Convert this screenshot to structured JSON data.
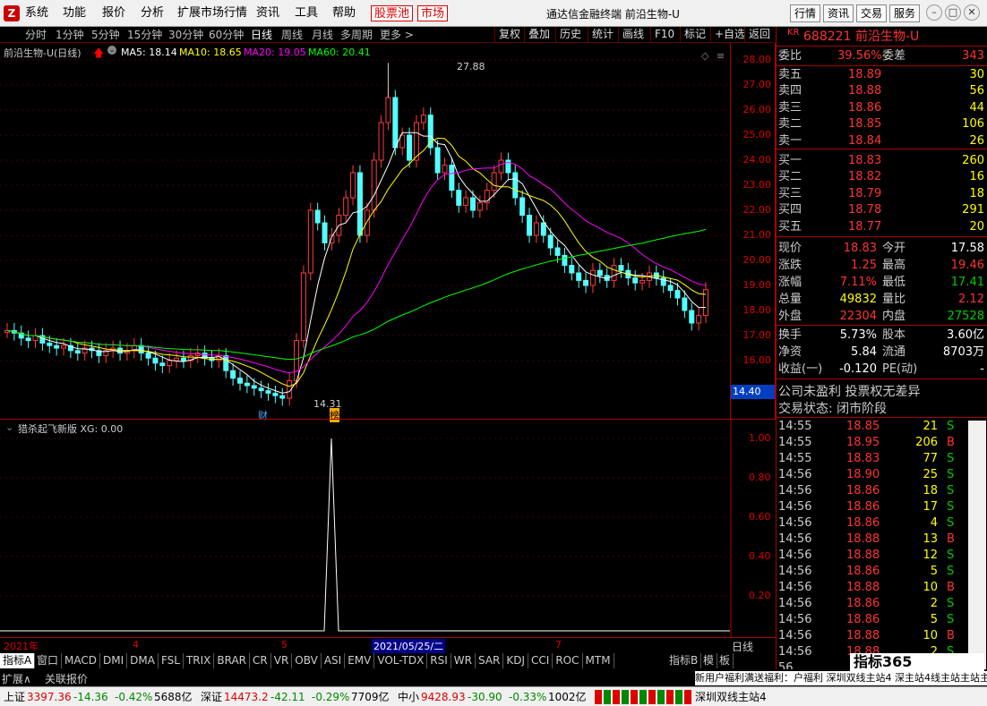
{
  "menu": {
    "items": [
      "系统",
      "功能",
      "报价",
      "分析",
      "扩展市场行情",
      "资讯",
      "工具",
      "帮助"
    ],
    "red_items": [
      "股票池",
      "市场"
    ],
    "window_title": "通达信金融终端 前沿生物-U",
    "right_buttons": [
      "行情",
      "资讯",
      "交易",
      "服务"
    ]
  },
  "toolbar": {
    "periods": [
      "分时",
      "1分钟",
      "5分钟",
      "15分钟",
      "30分钟",
      "60分钟",
      "日线",
      "周线",
      "月线",
      "多周期",
      "更多 >"
    ],
    "active_period": "日线",
    "right": [
      "复权",
      "叠加",
      "历史",
      "统计",
      "画线",
      "F10",
      "标记",
      "+自选",
      "返回"
    ]
  },
  "chart": {
    "title": "前沿生物-U(日线)",
    "ma": [
      {
        "label": "MA5: 18.14",
        "color": "#ffffff"
      },
      {
        "label": "MA10: 18.65",
        "color": "#ffff00"
      },
      {
        "label": "MA20: 19.05",
        "color": "#ff00ff"
      },
      {
        "label": "MA60: 20.41",
        "color": "#00ff00"
      }
    ],
    "high_label": "27.88",
    "low_label": "14.31",
    "cai_tag": "财",
    "bang_tag": "榜",
    "price_box": "14.40",
    "y_ticks": [
      "28.00",
      "27.00",
      "26.00",
      "25.00",
      "24.00",
      "23.00",
      "22.00",
      "21.00",
      "20.00",
      "19.00",
      "18.00",
      "17.00",
      "16.00"
    ]
  },
  "indicator": {
    "title": "猎杀起飞新版 XG: 0.00",
    "y_ticks": [
      "1.00",
      "0.80",
      "0.60",
      "0.40",
      "0.20"
    ]
  },
  "dates": {
    "labels": [
      "2021年",
      "4",
      "5",
      "2021/05/25/二",
      "7"
    ],
    "period_btn": "日线"
  },
  "tabs": {
    "first": "指标A",
    "items": [
      "窗口",
      "MACD",
      "DMI",
      "DMA",
      "FSL",
      "TRIX",
      "BRAR",
      "CR",
      "VR",
      "OBV",
      "ASI",
      "EMV",
      "VOL-TDX",
      "RSI",
      "WR",
      "SAR",
      "KDJ",
      "CCI",
      "ROC",
      "MTM"
    ],
    "right": [
      "指标B",
      "模",
      "板"
    ]
  },
  "bottom": {
    "left_tabs": [
      "扩展∧",
      "关联报价"
    ],
    "ticker": "新用户福利满送福利：户福利  深圳双线主站4  深主站4线主站主站主站主站"
  },
  "quote": {
    "kr": "KR",
    "code": "688221",
    "name": "前沿生物-U",
    "weibi_label": "委比",
    "weibi": "39.56%",
    "weicha_label": "委差",
    "weicha": "343",
    "asks": [
      {
        "label": "卖五",
        "price": "18.89",
        "vol": "30"
      },
      {
        "label": "卖四",
        "price": "18.88",
        "vol": "56"
      },
      {
        "label": "卖三",
        "price": "18.86",
        "vol": "44"
      },
      {
        "label": "卖二",
        "price": "18.85",
        "vol": "106"
      },
      {
        "label": "卖一",
        "price": "18.84",
        "vol": "26"
      }
    ],
    "bids": [
      {
        "label": "买一",
        "price": "18.83",
        "vol": "260"
      },
      {
        "label": "买二",
        "price": "18.82",
        "vol": "16"
      },
      {
        "label": "买三",
        "price": "18.79",
        "vol": "18"
      },
      {
        "label": "买四",
        "price": "18.78",
        "vol": "291"
      },
      {
        "label": "买五",
        "price": "18.77",
        "vol": "20"
      }
    ],
    "stats": [
      {
        "l1": "现价",
        "v1": "18.83",
        "c1": "vr",
        "l2": "今开",
        "v2": "17.58",
        "c2": "vw"
      },
      {
        "l1": "涨跌",
        "v1": "1.25",
        "c1": "vr",
        "l2": "最高",
        "v2": "19.46",
        "c2": "vr"
      },
      {
        "l1": "涨幅",
        "v1": "7.11%",
        "c1": "vr",
        "l2": "最低",
        "v2": "17.41",
        "c2": "vg"
      },
      {
        "l1": "总量",
        "v1": "49832",
        "c1": "vy",
        "l2": "量比",
        "v2": "2.12",
        "c2": "vr"
      },
      {
        "l1": "外盘",
        "v1": "22304",
        "c1": "vr",
        "l2": "内盘",
        "v2": "27528",
        "c2": "vg"
      }
    ],
    "stats2": [
      {
        "l1": "换手",
        "v1": "5.73%",
        "l2": "股本",
        "v2": "3.60亿"
      },
      {
        "l1": "净资",
        "v1": "5.84",
        "l2": "流通",
        "v2": "8703万"
      },
      {
        "l1": "收益(一)",
        "v1": "-0.120",
        "l2": "PE(动)",
        "v2": "-"
      }
    ],
    "note1": "公司未盈利 投票权无差异",
    "note2": "交易状态: 闭市阶段",
    "ticks": [
      {
        "t": "14:55",
        "p": "18.85",
        "v": "21",
        "s": "S"
      },
      {
        "t": "14:55",
        "p": "18.95",
        "v": "206",
        "s": "B"
      },
      {
        "t": "14:55",
        "p": "18.83",
        "v": "77",
        "s": "S"
      },
      {
        "t": "14:56",
        "p": "18.90",
        "v": "25",
        "s": "S"
      },
      {
        "t": "14:56",
        "p": "18.86",
        "v": "18",
        "s": "S"
      },
      {
        "t": "14:56",
        "p": "18.86",
        "v": "17",
        "s": "S"
      },
      {
        "t": "14:56",
        "p": "18.86",
        "v": "4",
        "s": "S"
      },
      {
        "t": "14:56",
        "p": "18.88",
        "v": "13",
        "s": "B"
      },
      {
        "t": "14:56",
        "p": "18.88",
        "v": "12",
        "s": "S"
      },
      {
        "t": "14:56",
        "p": "18.86",
        "v": "5",
        "s": "S"
      },
      {
        "t": "14:56",
        "p": "18.88",
        "v": "10",
        "s": "B"
      },
      {
        "t": "14:56",
        "p": "18.86",
        "v": "2",
        "s": "S"
      },
      {
        "t": "14:56",
        "p": "18.86",
        "v": "5",
        "s": "S"
      },
      {
        "t": "14:56",
        "p": "18.88",
        "v": "10",
        "s": "B"
      },
      {
        "t": "14:56",
        "p": "18.88",
        "v": "2",
        "s": "S"
      },
      {
        "t": "56",
        "p": "",
        "v": "",
        "s": ""
      }
    ]
  },
  "status": {
    "items": [
      {
        "name": "上证",
        "val": "3397.36",
        "chg": "-14.36",
        "pct": "-0.42%",
        "amt": "5688亿"
      },
      {
        "name": "深证",
        "val": "14473.2",
        "chg": "-42.11",
        "pct": "-0.29%",
        "amt": "7709亿"
      },
      {
        "name": "中小",
        "val": "9428.93",
        "chg": "-30.90",
        "pct": "-0.33%",
        "amt": "1002亿"
      }
    ],
    "server": "深圳双线主站4",
    "brand": "指标365"
  }
}
